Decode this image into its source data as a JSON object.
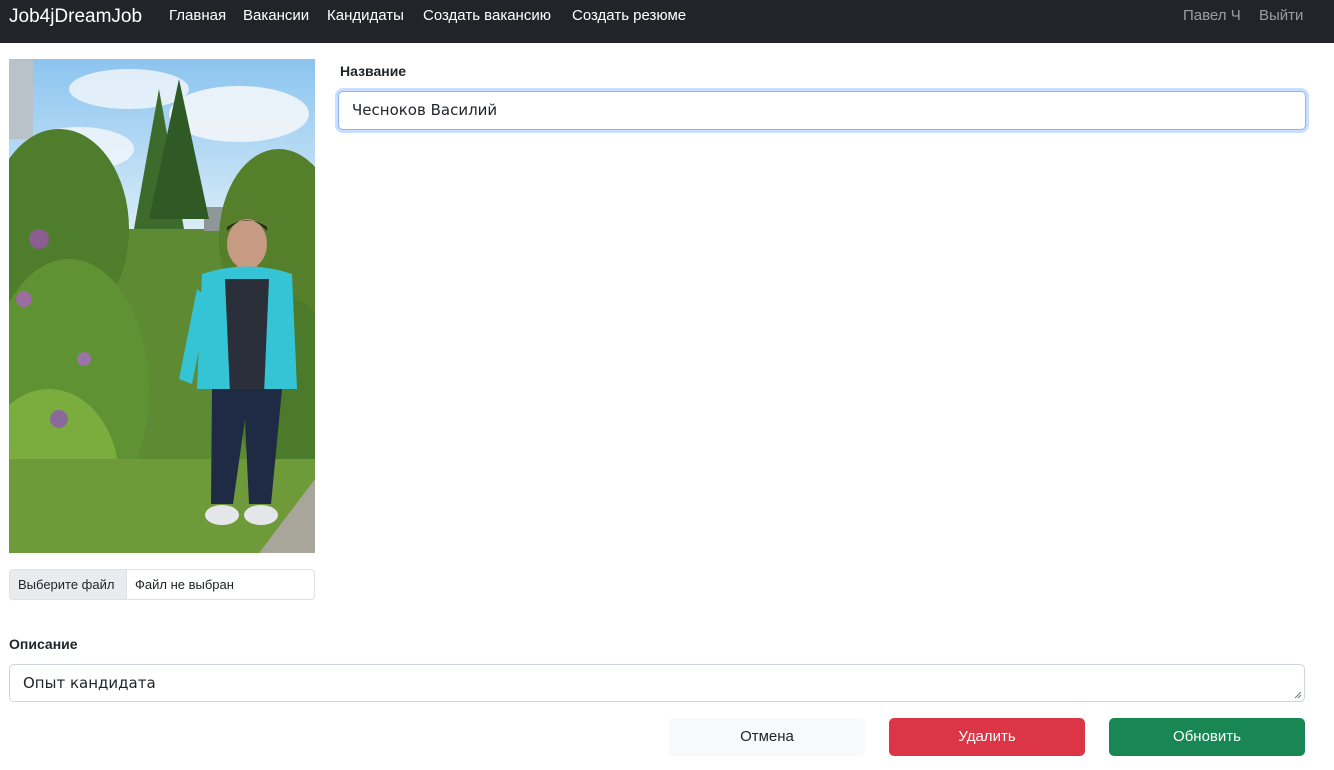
{
  "navbar": {
    "brand": "Job4jDreamJob",
    "links": [
      "Главная",
      "Вакансии",
      "Кандидаты",
      "Создать вакансию",
      "Создать резюме"
    ],
    "user": "Павел Ч",
    "logout": "Выйти"
  },
  "form": {
    "title_label": "Название",
    "title_value": "Чесноков Василий",
    "file_button": "Выберите файл",
    "file_status": "Файл не выбран",
    "description_label": "Описание",
    "description_value": "Опыт кандидата"
  },
  "buttons": {
    "cancel": "Отмена",
    "delete": "Удалить",
    "update": "Обновить"
  },
  "colors": {
    "navbar": "#212529",
    "delete": "#dc3545",
    "update": "#198754",
    "focus": "#86b7fe"
  }
}
